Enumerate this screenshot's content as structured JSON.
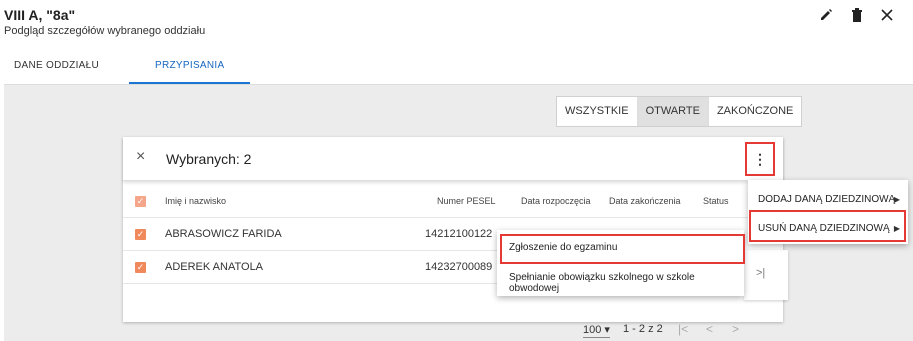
{
  "header": {
    "title": "VIII A, \"8a\"",
    "subtitle": "Podgląd szczegółów wybranego oddziału"
  },
  "icons": {
    "edit": "pencil-icon",
    "delete": "trash-icon",
    "close": "close-icon"
  },
  "tabs": [
    {
      "label": "DANE ODDZIAŁU",
      "active": false
    },
    {
      "label": "PRZYPISANIA",
      "active": true
    }
  ],
  "filters": [
    {
      "label": "WSZYSTKIE",
      "active": false
    },
    {
      "label": "OTWARTE",
      "active": true
    },
    {
      "label": "ZAKOŃCZONE",
      "active": false
    }
  ],
  "selection": {
    "close_glyph": "×",
    "label": "Wybranych: 2",
    "menu_glyph": "⋮"
  },
  "table": {
    "columns": [
      "Imię i nazwisko",
      "Numer PESEL",
      "Data rozpoczęcia",
      "Data zakończenia",
      "Status"
    ],
    "rows": [
      {
        "name": "ABRASOWICZ FARIDA",
        "pesel": "14212100122",
        "checked": true
      },
      {
        "name": "ADEREK ANATOLA",
        "pesel": "14232700089",
        "checked": true
      }
    ]
  },
  "pagination": {
    "page_size": "100 ▾",
    "range": "1 - 2 z 2",
    "first": "|<",
    "prev": "<",
    "next": ">",
    "last": ">|"
  },
  "context_menu": {
    "items": [
      {
        "label": "DODAJ DANĄ DZIEDZINOWĄ",
        "arrow": "▶"
      },
      {
        "label": "USUŃ DANĄ DZIEDZINOWĄ",
        "arrow": "▶",
        "highlighted": true
      }
    ]
  },
  "submenu": {
    "items": [
      {
        "label": "Zgłoszenie do egzaminu",
        "highlighted": true
      },
      {
        "label": "Spełnianie obowiązku szkolnego w szkole obwodowej"
      }
    ]
  },
  "colors": {
    "accent": "#1976d2",
    "highlight_border": "#e53935",
    "checkbox": "#f08a5d"
  }
}
